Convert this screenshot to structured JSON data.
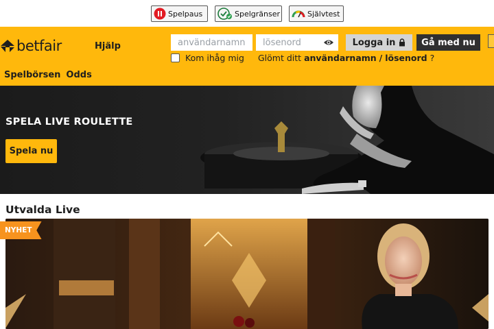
{
  "regulatory": {
    "pause_label": "Spelpaus",
    "limits_label": "Spelgränser",
    "test_label": "Självtest"
  },
  "header": {
    "logo_text": "betfair",
    "help_label": "Hjälp",
    "username_placeholder": "användarnamnet",
    "password_placeholder": "lösenord",
    "login_label": "Logga in",
    "join_label": "Gå med nu",
    "remember_label": "Kom ihåg mig",
    "forgot_prefix": "Glömt ditt",
    "forgot_username": "användarnamn",
    "forgot_separator": "/",
    "forgot_password": "lösenord",
    "forgot_suffix": "?"
  },
  "nav": {
    "items": [
      {
        "label": "Spelbörsen"
      },
      {
        "label": "Odds"
      }
    ]
  },
  "hero": {
    "title": "SPELA LIVE ROULETTE",
    "cta_label": "Spela nu"
  },
  "featured": {
    "title": "Utvalda Live",
    "badge": "NYHET"
  },
  "colors": {
    "brand_yellow": "#ffb80c",
    "dark": "#303030",
    "badge_orange": "#f7931e"
  }
}
